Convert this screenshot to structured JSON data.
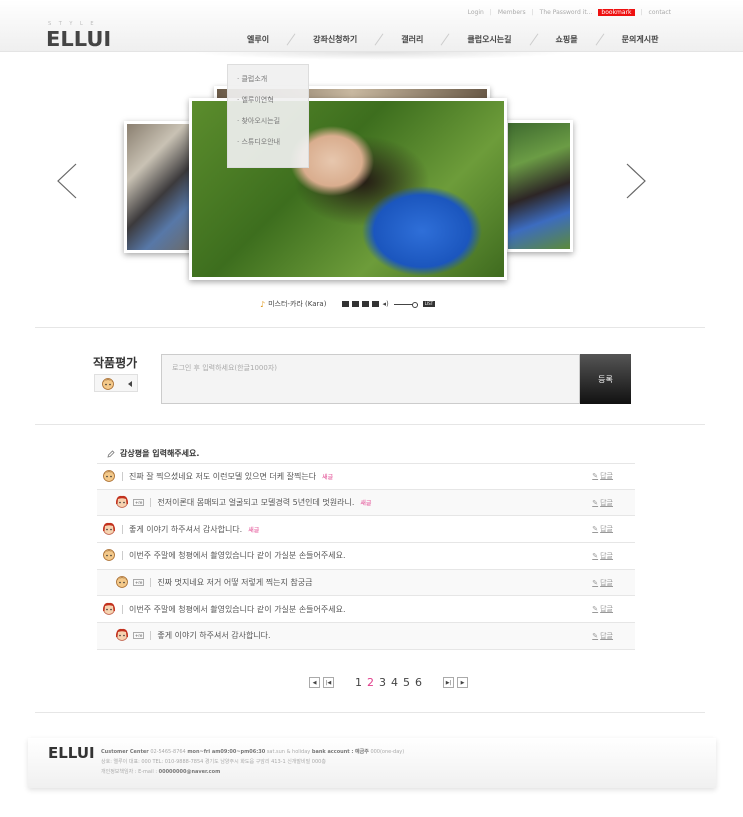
{
  "header": {
    "logo_sub": "S T Y L E",
    "logo": "ELLUI",
    "util": {
      "login": "Login",
      "members": "Members",
      "password": "The Password it...",
      "bookmark": "bookmark",
      "contact": "contact"
    },
    "nav": [
      "엘루이",
      "강좌신청하기",
      "갤러리",
      "클럽오시는길",
      "쇼핑몰",
      "문의게시판"
    ]
  },
  "dropdown": [
    "클럽소개",
    "엘루이연혁",
    "찾아오시는길",
    "스튜디오안내"
  ],
  "player": {
    "song": "미스터-카라 (Kara)",
    "list_label": "LIST"
  },
  "review": {
    "title": "작품평가",
    "placeholder": "로그인 후 입력하세요(한글1000자)",
    "submit_label": "등록"
  },
  "list_heading": "감상평을 입력해주세요.",
  "reply_label": "답글",
  "rebtn_label": "+re",
  "new_label": "새글",
  "comments": [
    {
      "text": "진짜 잘 찍으셨네요 저도 이런모델 있으면 더케 잘찍는다",
      "reply": false,
      "new": true,
      "avatar": "boy"
    },
    {
      "text": "전저이론대 몸매되고 얼굴되고 모델경력 5년인데 멋원라니.",
      "reply": true,
      "new": true,
      "avatar": "girl"
    },
    {
      "text": "좋게 이야기 하주셔서 감사합니다.",
      "reply": false,
      "new": true,
      "avatar": "girl"
    },
    {
      "text": "이번주 주말에 청평에서 촬영있습니다 같이 가실분 손들어주세요.",
      "reply": false,
      "new": false,
      "avatar": "boy"
    },
    {
      "text": "진짜 멋지네요 저거 어떻 저렇게 찍는지 참궁금",
      "reply": true,
      "new": false,
      "avatar": "boy"
    },
    {
      "text": "이번주 주말에 청평에서 촬영있습니다 같이 가실분 손들어주세요.",
      "reply": false,
      "new": false,
      "avatar": "girl"
    },
    {
      "text": "좋게 이야기 하주셔서 감사합니다.",
      "reply": true,
      "new": false,
      "avatar": "girl"
    }
  ],
  "pagination": {
    "pages": [
      "1",
      "2",
      "3",
      "4",
      "5",
      "6"
    ],
    "current": "2"
  },
  "footer": {
    "logo": "ELLUI",
    "line1_label": "Customer Center",
    "line1_phone": "02-5465-8764",
    "line1_hours": "mon~fri am09:00~pm06:30",
    "line1_holiday": "sat.sun & holiday",
    "line1_bank_label": "bank account :",
    "line1_bank": "예금주",
    "line1_bank_num": "000(one-day)",
    "line2": "상호: 엘루이  대표: 000  TEL: 010-9888-7854  경기도 남양주시 화도읍 구암리 413-1 신개발비빌 000층",
    "line3_label": "개인정보책임자 : E-mail :",
    "line3_email": "00000000@naver.com"
  },
  "colors": {
    "accent_pink": "#e03c8a",
    "bookmark_red": "#ee1111",
    "submit_dark": "#111111"
  }
}
